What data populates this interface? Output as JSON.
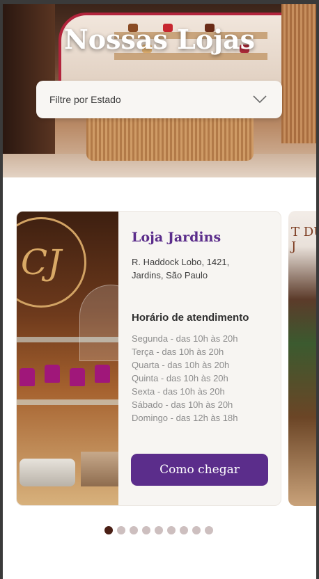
{
  "hero": {
    "title": "Nossas Lojas"
  },
  "filter": {
    "placeholder": "Filtre por Estado"
  },
  "store_card": {
    "name": "Loja Jardins",
    "address_line1": "R. Haddock Lobo, 1421,",
    "address_line2": "Jardins, São Paulo",
    "hours_title": "Horário de atendimento",
    "hours": [
      "Segunda - das 10h às 20h",
      "Terça - das 10h às 20h",
      "Quarta - das 10h às 20h",
      "Quinta - das 10h às 20h",
      "Sexta - das 10h às 20h",
      "Sábado - das 10h às 20h",
      "Domingo - das 12h às 18h"
    ],
    "button_label": "Como chegar",
    "logo_text": "CJ"
  },
  "next_card": {
    "sign_text": "T DU J"
  },
  "pagination": {
    "total": 9,
    "active_index": 0
  },
  "colors": {
    "brand_purple": "#5b2d8b",
    "dot_active": "#4a1f15",
    "dot_inactive": "#cdbfbf"
  }
}
